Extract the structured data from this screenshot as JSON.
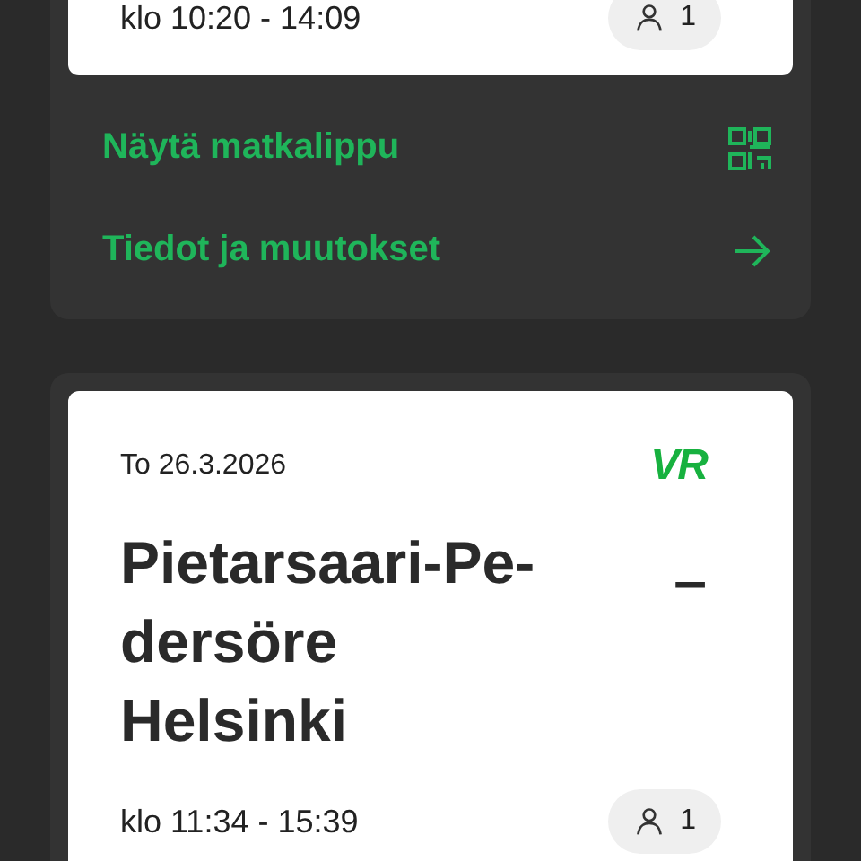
{
  "trips": [
    {
      "time": "klo 10:20 - 14:09",
      "passengers": "1",
      "actions": [
        {
          "label": "Näytä matkalippu",
          "kind": "qr"
        },
        {
          "label": "Tiedot ja muutokset",
          "kind": "arrow"
        }
      ]
    },
    {
      "date": "To 26.3.2026",
      "logo": "VR",
      "origin_lines": [
        "Pietarsaari-Pe-",
        "dersöre"
      ],
      "separator": "–",
      "destination": "Helsinki",
      "time": "klo 11:34 - 15:39",
      "passengers": "1"
    }
  ]
}
